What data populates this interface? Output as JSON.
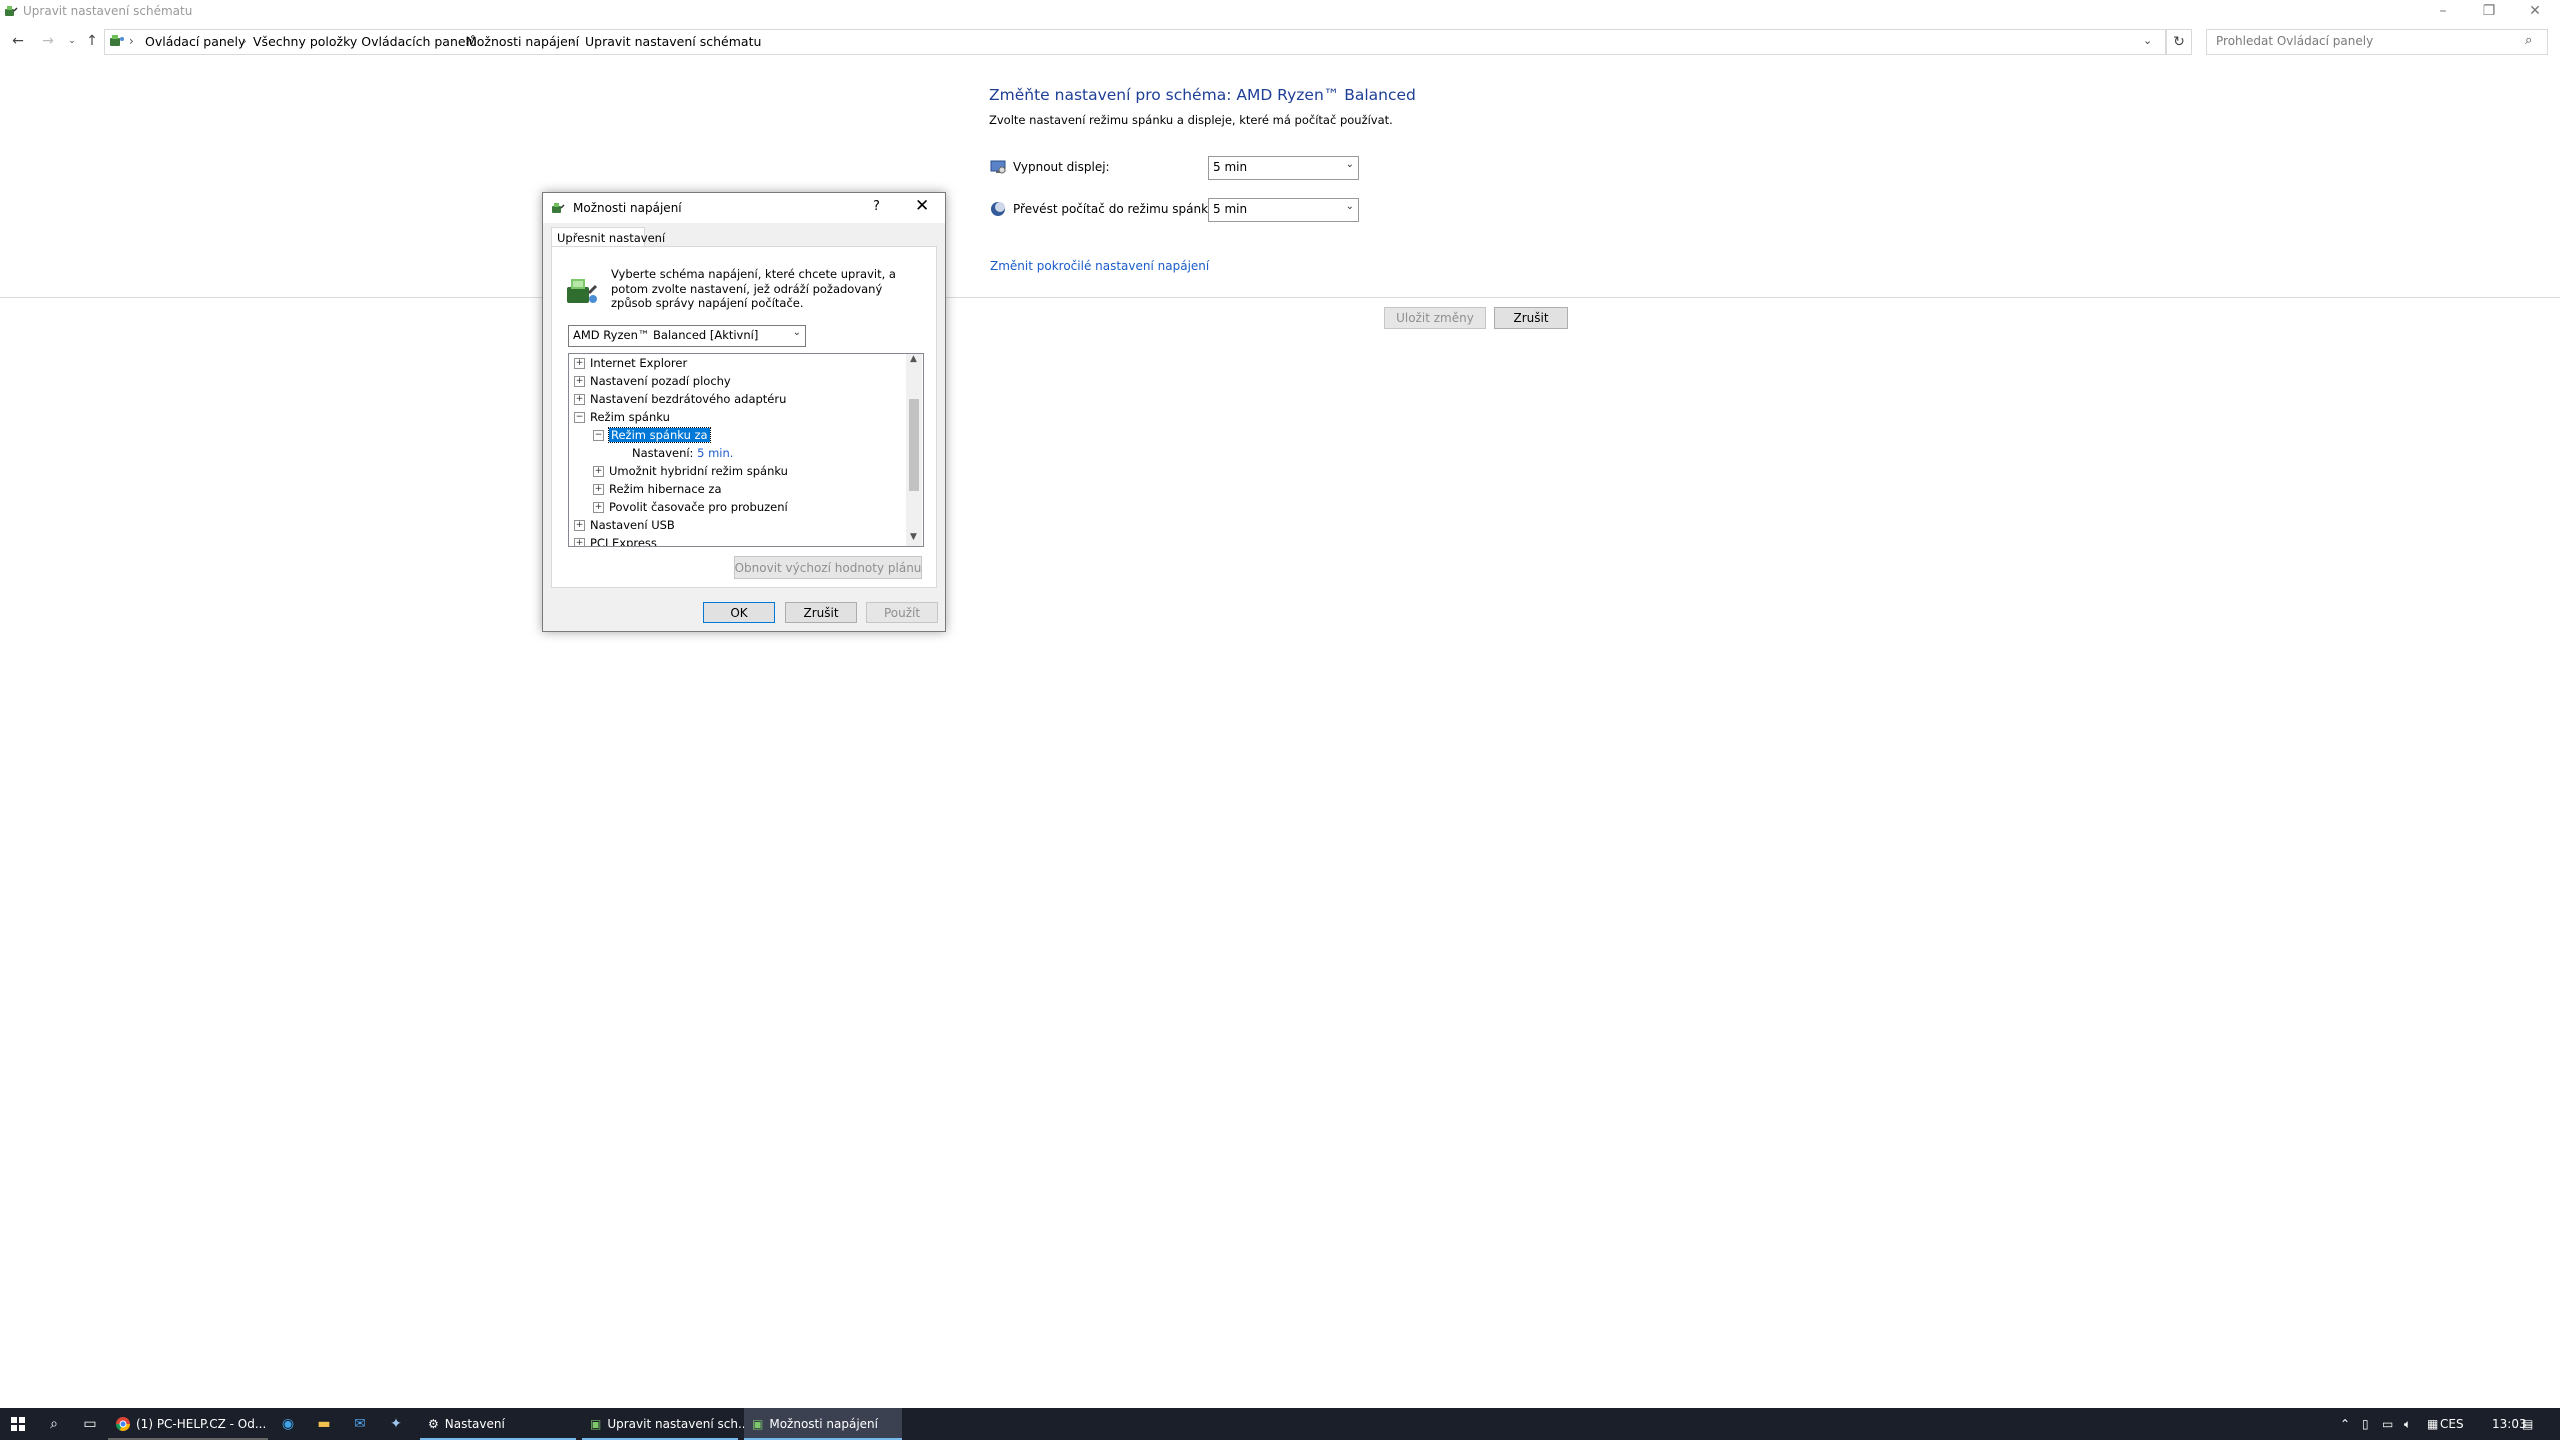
{
  "window": {
    "title": "Upravit nastavení schématu",
    "controls": {
      "minimize": "–",
      "restore": "❐",
      "close": "✕"
    }
  },
  "address_bar": {
    "breadcrumbs": [
      "Ovládací panely",
      "Všechny položky Ovládacích panelů",
      "Možnosti napájení",
      "Upravit nastavení schématu"
    ],
    "search_placeholder": "Prohledat Ovládací panely"
  },
  "main": {
    "heading": "Změňte nastavení pro schéma: AMD Ryzen™ Balanced",
    "subheading": "Zvolte nastavení režimu spánku a displeje, které má počítač používat.",
    "settings": [
      {
        "label": "Vypnout displej:",
        "value": "5 min",
        "icon": "monitor-icon"
      },
      {
        "label": "Převést počítač do režimu spánku:",
        "value": "5 min",
        "icon": "moon-icon"
      }
    ],
    "advanced_link": "Změnit pokročilé nastavení napájení",
    "save_button": "Uložit změny",
    "cancel_button": "Zrušit"
  },
  "dialog": {
    "title": "Možnosti napájení",
    "help": "?",
    "close": "✕",
    "tab": "Upřesnit nastavení",
    "description": "Vyberte schéma napájení, které chcete upravit, a potom zvolte nastavení, jež odráží požadovaný způsob správy napájení počítače.",
    "plan_selected": "AMD Ryzen™ Balanced [Aktivní]",
    "tree": [
      {
        "label": "Internet Explorer",
        "sign": "+",
        "level": 0
      },
      {
        "label": "Nastavení pozadí plochy",
        "sign": "+",
        "level": 0
      },
      {
        "label": "Nastavení bezdrátového adaptéru",
        "sign": "+",
        "level": 0
      },
      {
        "label": "Režim spánku",
        "sign": "−",
        "level": 0
      },
      {
        "label": "Režim spánku za",
        "sign": "−",
        "level": 1,
        "selected": true
      },
      {
        "label": "Nastavení:",
        "value": "5 min.",
        "level": 2
      },
      {
        "label": "Umožnit hybridní režim spánku",
        "sign": "+",
        "level": 1
      },
      {
        "label": "Režim hibernace za",
        "sign": "+",
        "level": 1
      },
      {
        "label": "Povolit časovače pro probuzení",
        "sign": "+",
        "level": 1
      },
      {
        "label": "Nastavení USB",
        "sign": "+",
        "level": 0
      },
      {
        "label": "PCI Express",
        "sign": "+",
        "level": 0
      }
    ],
    "restore_defaults_button": "Obnovit výchozí hodnoty plánu",
    "ok_button": "OK",
    "cancel_button": "Zrušit",
    "apply_button": "Použít"
  },
  "taskbar": {
    "tasks": [
      {
        "label": "(1) PC-HELP.CZ - Od...",
        "icon": "chrome-icon"
      },
      {
        "label": "Nastavení",
        "icon": "gear-icon"
      },
      {
        "label": "Upravit nastavení sch...",
        "icon": "power-options-icon"
      },
      {
        "label": "Možnosti napájení",
        "icon": "power-options-icon"
      }
    ],
    "language": "CES",
    "time": "13:03"
  }
}
